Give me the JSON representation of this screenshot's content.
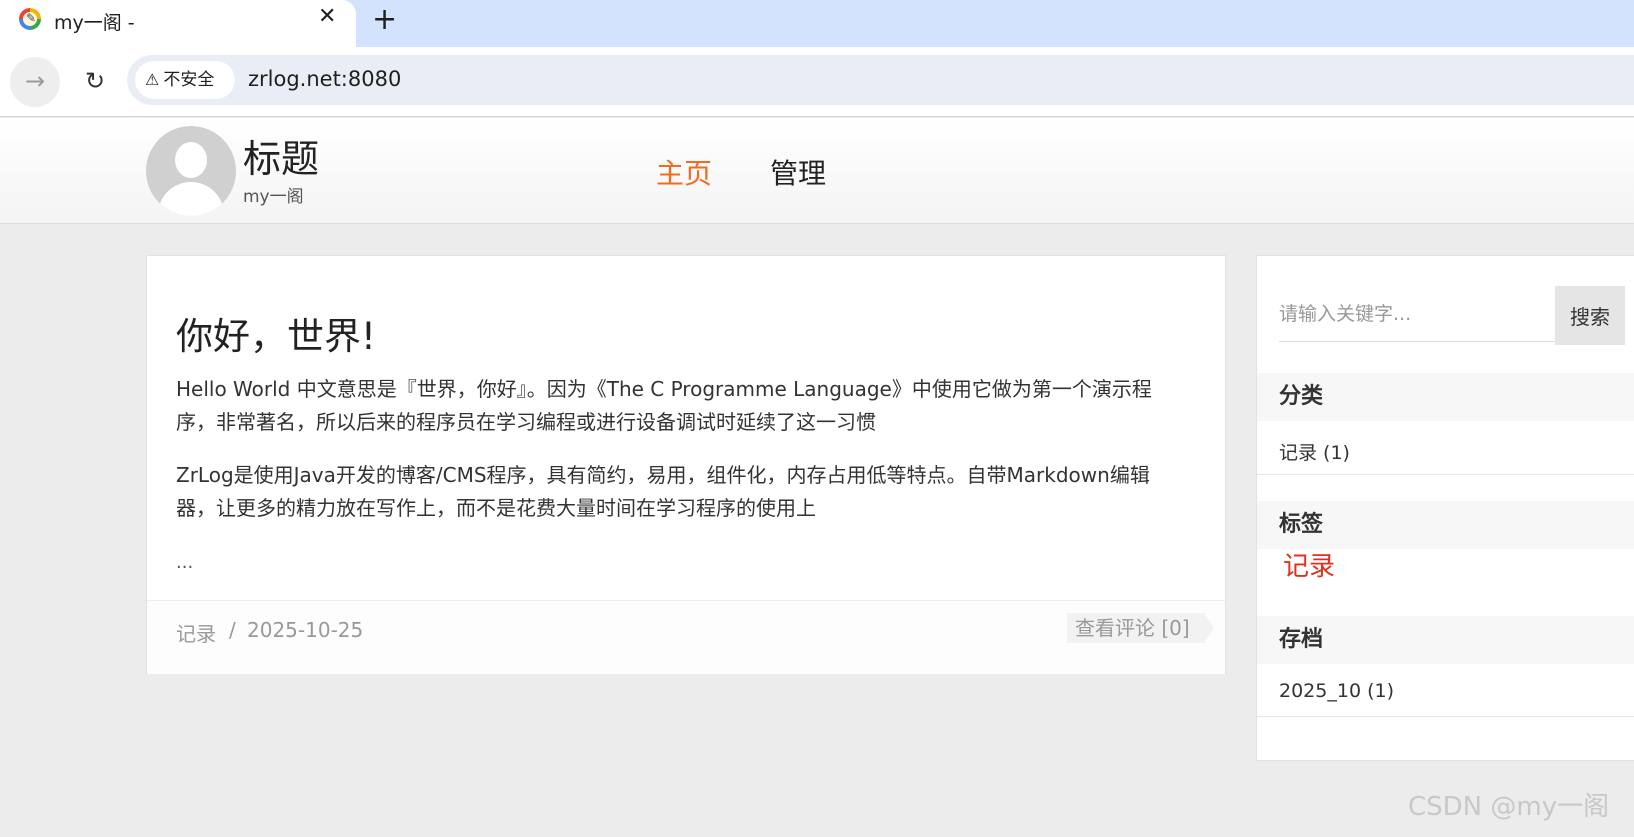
{
  "browser": {
    "tab_title": "my一阁 -",
    "tab_close_glyph": "✕",
    "new_tab_glyph": "+",
    "security_label": "不安全",
    "url": "zrlog.net:8080"
  },
  "site": {
    "title": "标题",
    "subtitle": "my一阁",
    "nav": [
      "主页",
      "管理"
    ],
    "accent_color": "#f26b1d"
  },
  "article": {
    "title": "你好，世界!",
    "paragraphs": [
      "Hello World 中文意思是『世界，你好』。因为《The C Programme Language》中使用它做为第一个演示程序，非常著名，所以后来的程序员在学习编程或进行设备调试时延续了这一习惯",
      "ZrLog是使用Java开发的博客/CMS程序，具有简约，易用，组件化，内存占用低等特点。自带Markdown编辑器，让更多的精力放在写作上，而不是花费大量时间在学习程序的使用上"
    ],
    "more": "...",
    "category": "记录",
    "separator": "/",
    "date": "2025-10-25",
    "comments_label": "查看评论 [0]"
  },
  "sidebar": {
    "search_placeholder": "请输入关键字...",
    "search_button": "搜索",
    "categories_heading": "分类",
    "categories": [
      "记录 (1)"
    ],
    "tags_heading": "标签",
    "tags": [
      "记录"
    ],
    "archive_heading": "存档",
    "archives": [
      "2025_10 (1)"
    ],
    "tag_color": "#e0301e"
  },
  "watermark": "CSDN @my一阁"
}
